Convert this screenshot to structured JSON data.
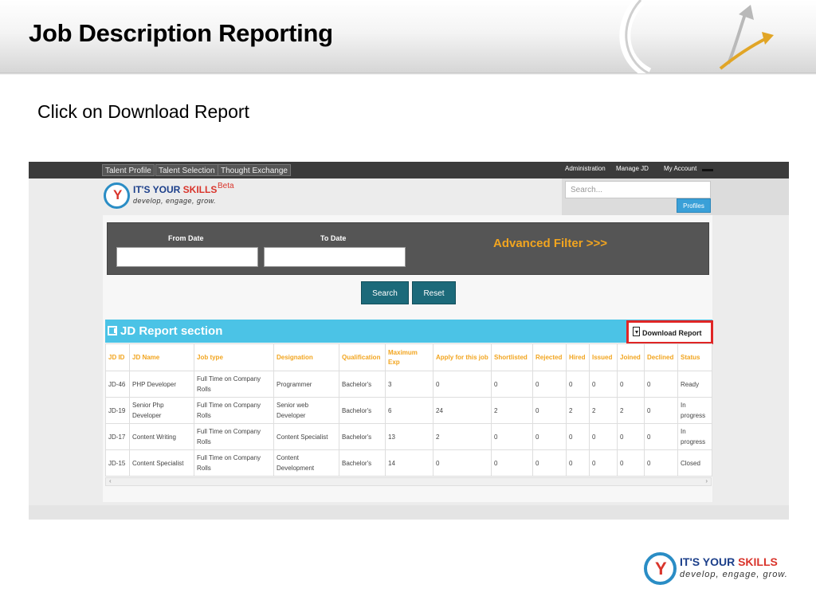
{
  "slide": {
    "title": "Job Description Reporting",
    "instruction": "Click on Download Report"
  },
  "app": {
    "nav_tabs": [
      "Talent Profile",
      "Talent Selection",
      "Thought Exchange"
    ],
    "right_links": [
      "Administration",
      "Manage JD",
      "My Account"
    ],
    "logo_main": "IT'S YOUR ",
    "logo_accent": "SKILLS",
    "logo_beta": "Beta",
    "logo_tagline": "develop, engage, grow.",
    "search_placeholder": "Search...",
    "profiles_label": "Profiles"
  },
  "filter": {
    "from_label": "From Date",
    "to_label": "To Date",
    "from_value": "",
    "to_value": "",
    "advanced_label": "Advanced Filter >>>",
    "search_label": "Search",
    "reset_label": "Reset"
  },
  "report": {
    "section_title": "JD Report section",
    "download_label": "Download Report",
    "columns": [
      "JD ID",
      "JD Name",
      "Job type",
      "Designation",
      "Qualification",
      "Maximum Exp",
      "Apply for this job",
      "Shortlisted",
      "Rejected",
      "Hired",
      "Issued",
      "Joined",
      "Declined",
      "Status"
    ],
    "rows": [
      [
        "JD-46",
        "PHP Developer",
        "Full Time on Company Rolls",
        "Programmer",
        "Bachelor's",
        "3",
        "0",
        "0",
        "0",
        "0",
        "0",
        "0",
        "0",
        "Ready"
      ],
      [
        "JD-19",
        "Senior Php Developer",
        "Full Time on Company Rolls",
        "Senior web Developer",
        "Bachelor's",
        "6",
        "24",
        "2",
        "0",
        "2",
        "2",
        "2",
        "0",
        "In progress"
      ],
      [
        "JD-17",
        "Content Writing",
        "Full Time on Company Rolls",
        "Content Specialist",
        "Bachelor's",
        "13",
        "2",
        "0",
        "0",
        "0",
        "0",
        "0",
        "0",
        "In progress"
      ],
      [
        "JD-15",
        "Content Specialist",
        "Full Time on Company Rolls",
        "Content Development",
        "Bachelor's",
        "14",
        "0",
        "0",
        "0",
        "0",
        "0",
        "0",
        "0",
        "Closed"
      ]
    ]
  },
  "branding": {
    "logo_main": "IT'S YOUR ",
    "logo_accent": "SKILLS",
    "tagline": "develop, engage, grow."
  },
  "colors": {
    "section_bar": "#4bc3e6",
    "column_header": "#f2a51f",
    "button": "#1c6a7a",
    "highlight_box": "#e02525"
  }
}
